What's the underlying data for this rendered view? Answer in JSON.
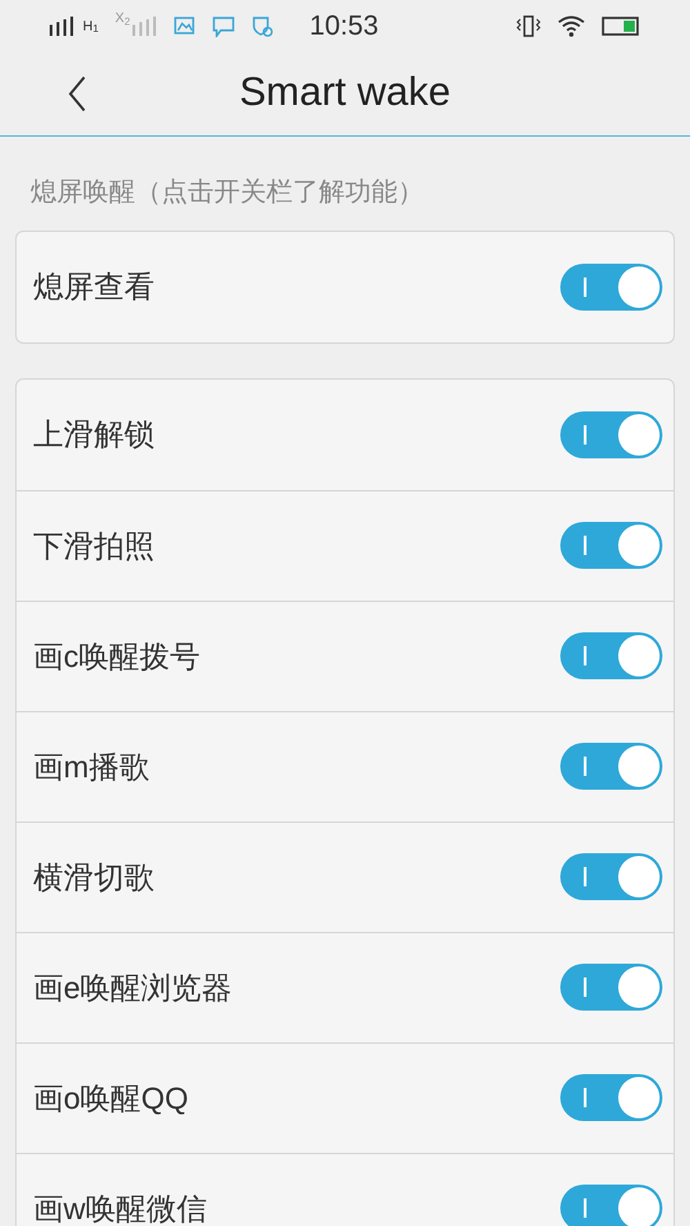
{
  "status_bar": {
    "network_label": "H$_{1}$",
    "sim2_label": "X$_{2}$",
    "time": "10:53"
  },
  "header": {
    "title": "Smart wake"
  },
  "section_label": "熄屏唤醒（点击开关栏了解功能）",
  "groups": [
    {
      "items": [
        {
          "label": "熄屏查看",
          "on": true
        }
      ]
    },
    {
      "items": [
        {
          "label": "上滑解锁",
          "on": true
        },
        {
          "label": "下滑拍照",
          "on": true
        },
        {
          "label": "画c唤醒拨号",
          "on": true
        },
        {
          "label": "画m播歌",
          "on": true
        },
        {
          "label": "横滑切歌",
          "on": true
        },
        {
          "label": "画e唤醒浏览器",
          "on": true
        },
        {
          "label": "画o唤醒QQ",
          "on": true
        },
        {
          "label": "画w唤醒微信",
          "on": true
        }
      ]
    }
  ]
}
